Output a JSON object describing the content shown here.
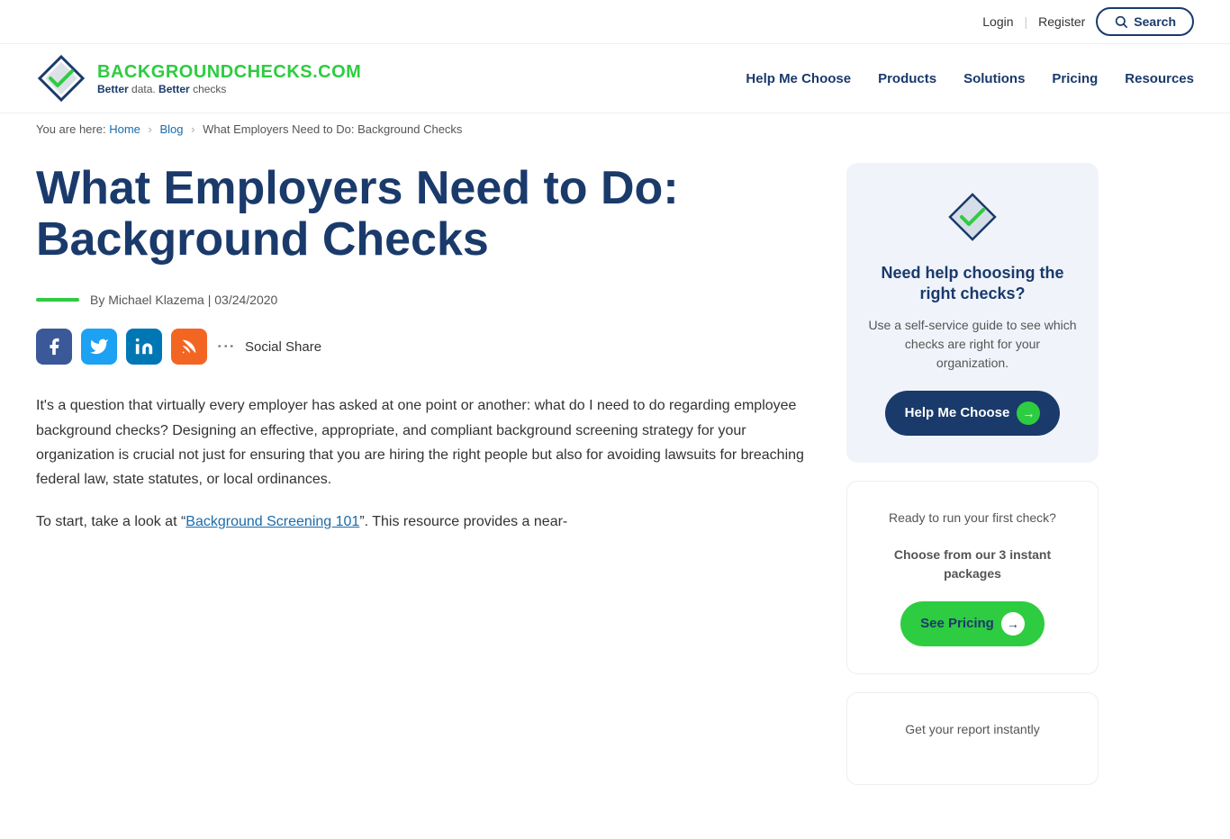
{
  "topbar": {
    "login_label": "Login",
    "register_label": "Register",
    "search_label": "Search"
  },
  "header": {
    "logo_main_text": "BACKGROUNDCHECKS",
    "logo_main_suffix": ".COM",
    "logo_sub_text_1": "Better",
    "logo_sub_text_2": " data. ",
    "logo_sub_text_3": "Better",
    "logo_sub_text_4": " checks",
    "nav": {
      "help_me_choose": "Help Me Choose",
      "products": "Products",
      "solutions": "Solutions",
      "pricing": "Pricing",
      "resources": "Resources"
    }
  },
  "breadcrumb": {
    "you_are_here": "You are here:",
    "home": "Home",
    "blog": "Blog",
    "current": "What Employers Need to Do: Background Checks"
  },
  "article": {
    "title": "What Employers Need to Do: Background Checks",
    "author_label": "By Michael Klazema | 03/24/2020",
    "social_share_label": "Social Share",
    "body_p1": "It's a question that virtually every employer has asked at one point or another: what do I need to do regarding employee background checks? Designing an effective, appropriate, and compliant background screening strategy for your organization is crucial not just for ensuring that you are hiring the right people but also for avoiding lawsuits for breaching federal law, state statutes, or local ordinances.",
    "body_p2_prefix": "To start, take a look at “",
    "body_p2_link": "Background Screening 101",
    "body_p2_suffix": "”. This resource provides a near-"
  },
  "sidebar": {
    "card1": {
      "title": "Need help choosing the right checks?",
      "description": "Use a self-service guide to see which checks are right for your organization.",
      "btn_label": "Help Me Choose"
    },
    "card2": {
      "title": "Ready to run your first check?",
      "subtitle": "Choose from our 3 instant packages",
      "btn_label": "See Pricing"
    },
    "card3": {
      "text": "Get your report instantly"
    }
  }
}
